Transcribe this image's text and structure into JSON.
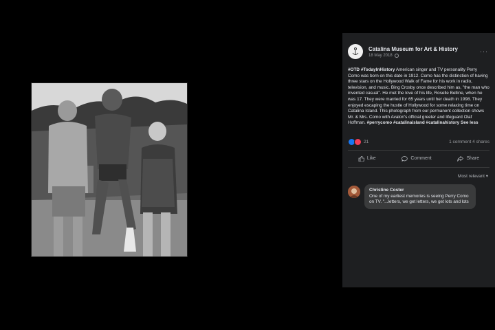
{
  "post": {
    "page_name": "Catalina Museum for Art & History",
    "date": "18 May 2018",
    "more_label": "···",
    "body_tags": "#OTD #TodayInHistory",
    "body_text": " American singer and TV personality Perry Como was born on this date in 1912. Como has the distinction of having three stars on the Hollywood Walk of Fame for his work in radio, television, and music. Bing Crosby once described him as, \"the man who invented casual\". He met the love of his life, Roselle Belline, when he was 17. They were married for 65 years until her death in 1998. They enjoyed escaping the hustle of Hollywood for some relaxing time on Catalina Island. This photograph from our permanent collection shows Mr. & Mrs. Como with Avalon's official greeter and lifeguard Olaf Hoffman. ",
    "body_hashtags": "#perrycomo #catalinaisland #catalinahistory",
    "see_less": "See less",
    "reaction_count": "21",
    "comments_shares": "1 comment  4 shares"
  },
  "actions": {
    "like": "Like",
    "comment": "Comment",
    "share": "Share"
  },
  "sort_label": "Most relevant ▾",
  "comment": {
    "author": "Christine Coster",
    "text": "One of my earliest memories is seeing Perry Como on TV. \"...letters, we get letters, we get lots and lots"
  },
  "colors": {
    "background": "#000000",
    "panel": "#1e1f21",
    "like": "#1877f2",
    "love": "#f33e58"
  }
}
